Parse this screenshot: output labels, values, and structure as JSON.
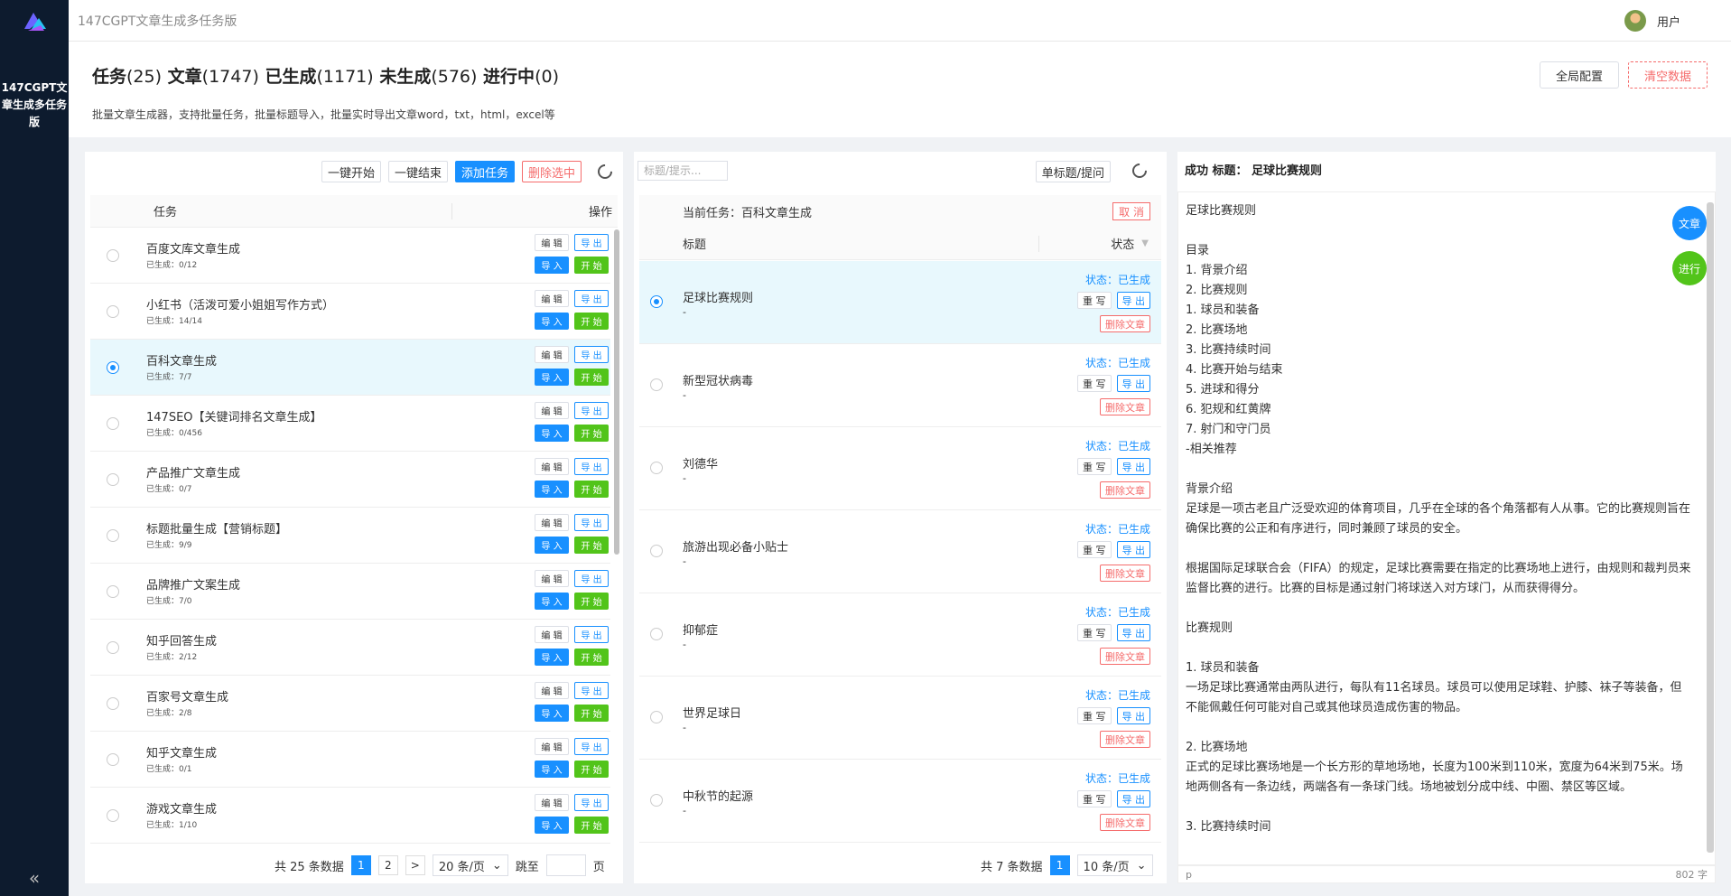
{
  "app": {
    "title": "147CGPT文章生成多任务版",
    "sidebar_title": "147CGPT文章生成多任务版",
    "collapse": "«",
    "user": "用户"
  },
  "header": {
    "stats": [
      {
        "label": "任务",
        "count": "(25)"
      },
      {
        "label": "文章",
        "count": "(1747)"
      },
      {
        "label": "已生成",
        "count": "(1171)"
      },
      {
        "label": "未生成",
        "count": "(576)"
      },
      {
        "label": "进行中",
        "count": "(0)"
      }
    ],
    "desc": "批量文章生成器，支持批量任务，批量标题导入，批量实时导出文章word，txt，html，excel等",
    "global_config": "全局配置",
    "clear_data": "清空数据"
  },
  "tasks_panel": {
    "start_all": "一键开始",
    "end_all": "一键结束",
    "add_task": "添加任务",
    "delete_selected": "删除选中",
    "col_task": "任务",
    "col_ops": "操作",
    "op_edit": "编 辑",
    "op_export": "导 出",
    "op_import": "导 入",
    "op_start": "开 始",
    "rows": [
      {
        "name": "百度文库文章生成",
        "sub": "已生成：0/12"
      },
      {
        "name": "小红书（活泼可爱小姐姐写作方式）",
        "sub": "已生成：14/14"
      },
      {
        "name": "百科文章生成",
        "sub": "已生成：7/7"
      },
      {
        "name": "147SEO【关键词排名文章生成】",
        "sub": "已生成：0/456"
      },
      {
        "name": "产品推广文章生成",
        "sub": "已生成：0/7"
      },
      {
        "name": "标题批量生成【营销标题】",
        "sub": "已生成：9/9"
      },
      {
        "name": "品牌推广文案生成",
        "sub": "已生成：7/0"
      },
      {
        "name": "知乎回答生成",
        "sub": "已生成：2/12"
      },
      {
        "name": "百家号文章生成",
        "sub": "已生成：2/8"
      },
      {
        "name": "知乎文章生成",
        "sub": "已生成：0/1"
      },
      {
        "name": "游戏文章生成",
        "sub": "已生成：1/10"
      }
    ],
    "selected_index": 2,
    "pager": {
      "total": "共 25 条数据",
      "pages": [
        "1",
        "2"
      ],
      "current": "1",
      "next": ">",
      "per_page": "20 条/页",
      "jump_label": "跳至",
      "page_label": "页"
    }
  },
  "articles_panel": {
    "search_placeholder": "标题/提示...",
    "single_btn": "单标题/提问",
    "current_task": "当前任务：百科文章生成",
    "cancel": "取 消",
    "col_title": "标题",
    "col_status": "状态",
    "status_text": "状态：已生成",
    "op_rewrite": "重 写",
    "op_export": "导 出",
    "op_delete": "删除文章",
    "rows": [
      {
        "title": "足球比赛规则",
        "sub": "-"
      },
      {
        "title": "新型冠状病毒",
        "sub": "-"
      },
      {
        "title": "刘德华",
        "sub": "-"
      },
      {
        "title": "旅游出现必备小贴士",
        "sub": "-"
      },
      {
        "title": "抑郁症",
        "sub": "-"
      },
      {
        "title": "世界足球日",
        "sub": "-"
      },
      {
        "title": "中秋节的起源",
        "sub": "-"
      }
    ],
    "selected_index": 0,
    "pager": {
      "total": "共 7 条数据",
      "current": "1",
      "per_page": "10 条/页"
    }
  },
  "content_panel": {
    "title": "成功 标题： 足球比赛规则",
    "btn_article": "文章",
    "btn_progress": "进行",
    "text": "足球比赛规则\n\n目录\n1. 背景介绍\n2. 比赛规则\n1. 球员和装备\n2. 比赛场地\n3. 比赛持续时间\n4. 比赛开始与结束\n5. 进球和得分\n6. 犯规和红黄牌\n7. 射门和守门员\n-相关推荐\n\n背景介绍\n足球是一项古老且广泛受欢迎的体育项目，几乎在全球的各个角落都有人从事。它的比赛规则旨在确保比赛的公正和有序进行，同时兼顾了球员的安全。\n\n根据国际足球联合会（FIFA）的规定，足球比赛需要在指定的比赛场地上进行，由规则和裁判员来监督比赛的进行。比赛的目标是通过射门将球送入对方球门，从而获得得分。\n\n比赛规则\n\n1. 球员和装备\n一场足球比赛通常由两队进行，每队有11名球员。球员可以使用足球鞋、护膝、袜子等装备，但不能佩戴任何可能对自己或其他球员造成伤害的物品。\n\n2. 比赛场地\n正式的足球比赛场地是一个长方形的草地场地，长度为100米到110米，宽度为64米到75米。场地两侧各有一条边线，两端各有一条球门线。场地被划分成中线、中圈、禁区等区域。\n\n3. 比赛持续时间",
    "footer_left": "p",
    "footer_right": "802 字"
  }
}
